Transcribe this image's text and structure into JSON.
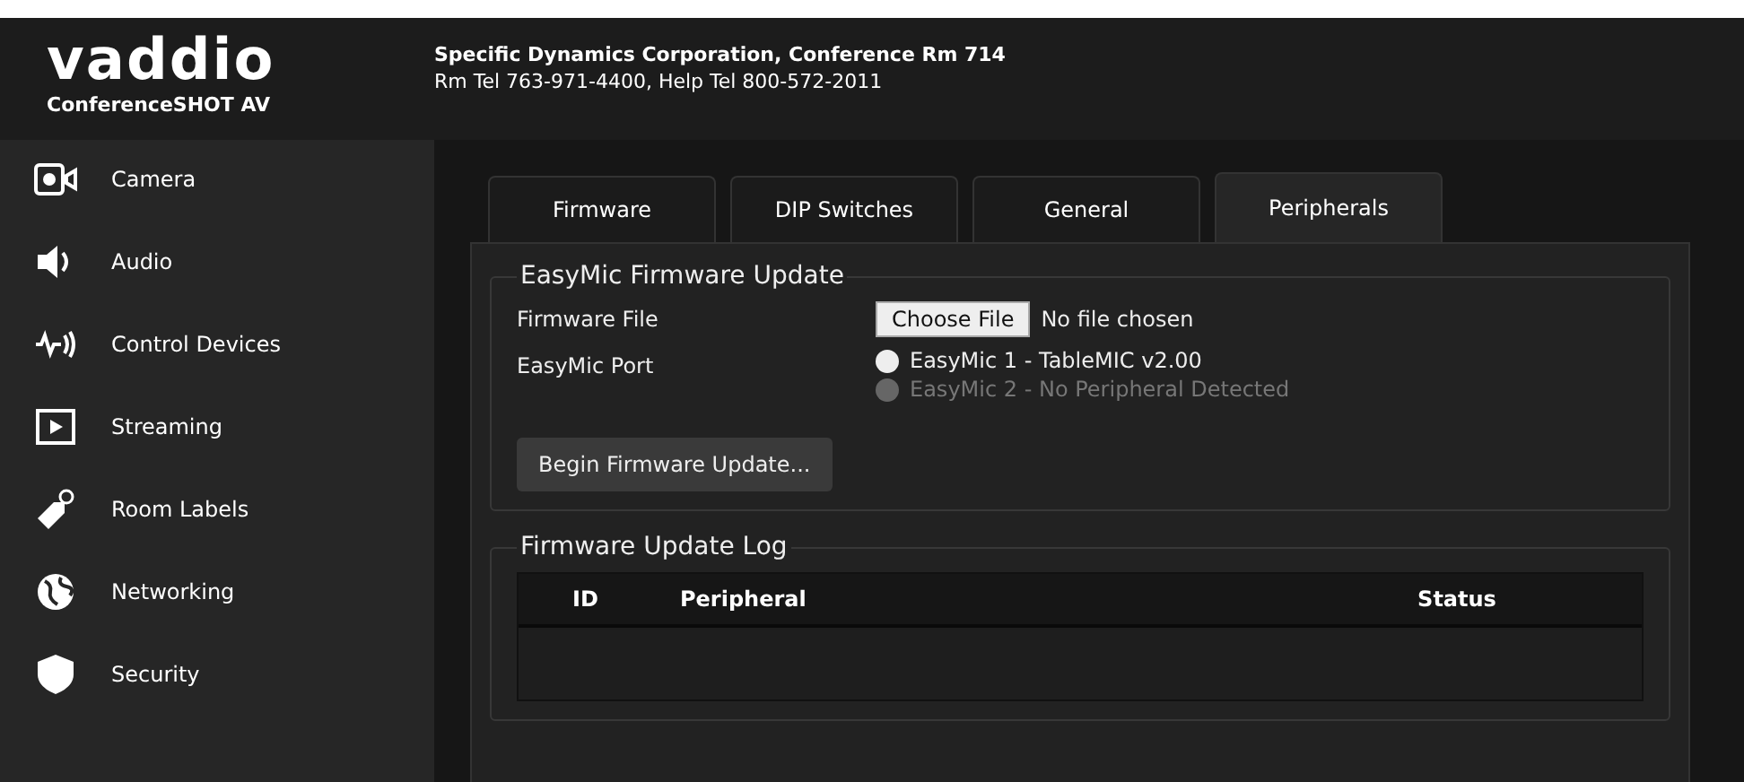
{
  "header": {
    "logo": "vaddio",
    "product": "ConferenceSHOT AV",
    "title": "Specific Dynamics Corporation, Conference Rm 714",
    "subtitle": "Rm Tel 763-971-4400, Help Tel 800-572-2011"
  },
  "sidebar": {
    "items": [
      {
        "label": "Camera"
      },
      {
        "label": "Audio"
      },
      {
        "label": "Control Devices"
      },
      {
        "label": "Streaming"
      },
      {
        "label": "Room Labels"
      },
      {
        "label": "Networking"
      },
      {
        "label": "Security"
      }
    ]
  },
  "tabs": [
    {
      "label": "Firmware",
      "selected": false
    },
    {
      "label": "DIP Switches",
      "selected": false
    },
    {
      "label": "General",
      "selected": false
    },
    {
      "label": "Peripherals",
      "selected": true
    }
  ],
  "update_section": {
    "legend": "EasyMic Firmware Update",
    "firmware_file": {
      "label": "Firmware File",
      "button": "Choose File",
      "value": "No file chosen"
    },
    "port": {
      "label": "EasyMic Port",
      "options": [
        {
          "label": "EasyMic 1 - TableMIC v2.00",
          "disabled": false
        },
        {
          "label": "EasyMic 2 - No Peripheral Detected",
          "disabled": true
        }
      ]
    },
    "button": "Begin Firmware Update..."
  },
  "log_section": {
    "legend": "Firmware Update Log",
    "columns": [
      "ID",
      "Peripheral",
      "Status"
    ]
  }
}
